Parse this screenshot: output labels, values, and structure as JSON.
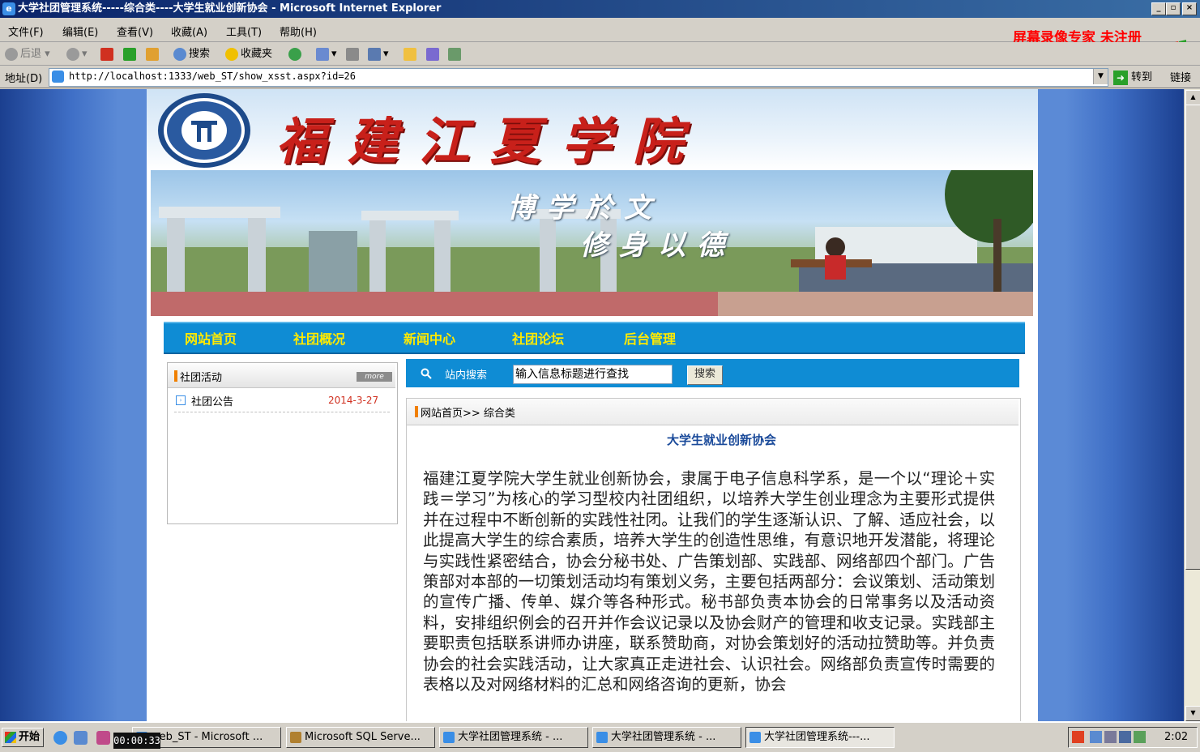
{
  "window": {
    "title": "大学社团管理系统-----综合类----大学生就业创新协会 - Microsoft Internet Explorer",
    "min_label": "_",
    "max_label": "▫",
    "close_label": "×"
  },
  "menu": [
    "文件(F)",
    "编辑(E)",
    "查看(V)",
    "收藏(A)",
    "工具(T)",
    "帮助(H)"
  ],
  "watermark": "屏幕录像专家 未注册",
  "toolbar": {
    "back_label": "后退",
    "search_label": "搜索",
    "favorites_label": "收藏夹"
  },
  "address": {
    "label": "地址(D)",
    "url": "http://localhost:1333/web_ST/show_xsst.aspx?id=26",
    "go_label": "转到",
    "links_label": "链接"
  },
  "site": {
    "school_name": "福建江夏学院",
    "logo_text": "福建江夏学院",
    "motto_line1": "博学於文",
    "motto_line2": "修身以德",
    "nav": [
      "网站首页",
      "社团概况",
      "新闻中心",
      "社团论坛",
      "后台管理"
    ]
  },
  "sidebar": {
    "heading": "社团活动",
    "more_label": "more",
    "items": [
      {
        "label": "社团公告",
        "date": "2014-3-27"
      }
    ]
  },
  "search": {
    "label": "站内搜索",
    "input_value": "输入信息标题进行查找",
    "button_label": "搜索"
  },
  "article": {
    "breadcrumb": "网站首页>> 综合类",
    "title": "大学生就业创新协会",
    "body": "福建江夏学院大学生就业创新协会，隶属于电子信息科学系，是一个以“理论＋实践＝学习”为核心的学习型校内社团组织，以培养大学生创业理念为主要形式提供并在过程中不断创新的实践性社团。让我们的学生逐渐认识、了解、适应社会，以此提高大学生的综合素质，培养大学生的创造性思维，有意识地开发潜能，将理论与实践性紧密结合，协会分秘书处、广告策划部、实践部、网络部四个部门。广告策部对本部的一切策划活动均有策划义务，主要包括两部分：会议策划、活动策划的宣传广播、传单、媒介等各种形式。秘书部负责本协会的日常事务以及活动资料，安排组织例会的召开并作会议记录以及协会财产的管理和收支记录。实践部主要职责包括联系讲师办讲座，联系赞助商，对协会策划好的活动拉赞助等。并负责协会的社会实践活动，让大家真正走进社会、认识社会。网络部负责宣传时需要的表格以及对网络材料的汇总和网络咨询的更新，协会"
  },
  "taskbar": {
    "start_label": "开始",
    "recorder_time": "00:00:33",
    "tasks": [
      {
        "label": "web_ST - Microsoft ..."
      },
      {
        "label": "Microsoft SQL Serve..."
      },
      {
        "label": "大学社团管理系统 - ..."
      },
      {
        "label": "大学社团管理系统 - ..."
      },
      {
        "label": "大学社团管理系统---..."
      }
    ],
    "clock": "2:02"
  },
  "colors": {
    "nav_bg": "#0f8cd4",
    "nav_text": "#ffea00",
    "title_blue": "#1a4a9a",
    "date_red": "#d03020",
    "school_red": "#c8201a"
  }
}
